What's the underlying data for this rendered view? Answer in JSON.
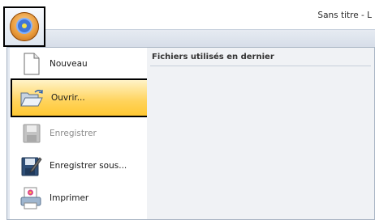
{
  "window": {
    "title": "Sans titre - L"
  },
  "app_menu": {
    "recent_header": "Fichiers utilisés en dernier",
    "items": [
      {
        "label": "Nouveau",
        "enabled": true
      },
      {
        "label": "Ouvrir...",
        "enabled": true,
        "highlighted": true
      },
      {
        "label": "Enregistrer",
        "enabled": false
      },
      {
        "label": "Enregistrer sous...",
        "enabled": true
      },
      {
        "label": "Imprimer",
        "enabled": true,
        "has_submenu": true
      }
    ]
  },
  "icons": [
    "application-orb-icon",
    "new-document-icon",
    "open-folder-icon",
    "save-icon",
    "save-as-icon",
    "print-icon",
    "submenu-arrow-icon"
  ],
  "colors": {
    "highlight": "#ffd35a",
    "panel": "#f0f2f5",
    "ribbon": "#dfe6ef"
  }
}
